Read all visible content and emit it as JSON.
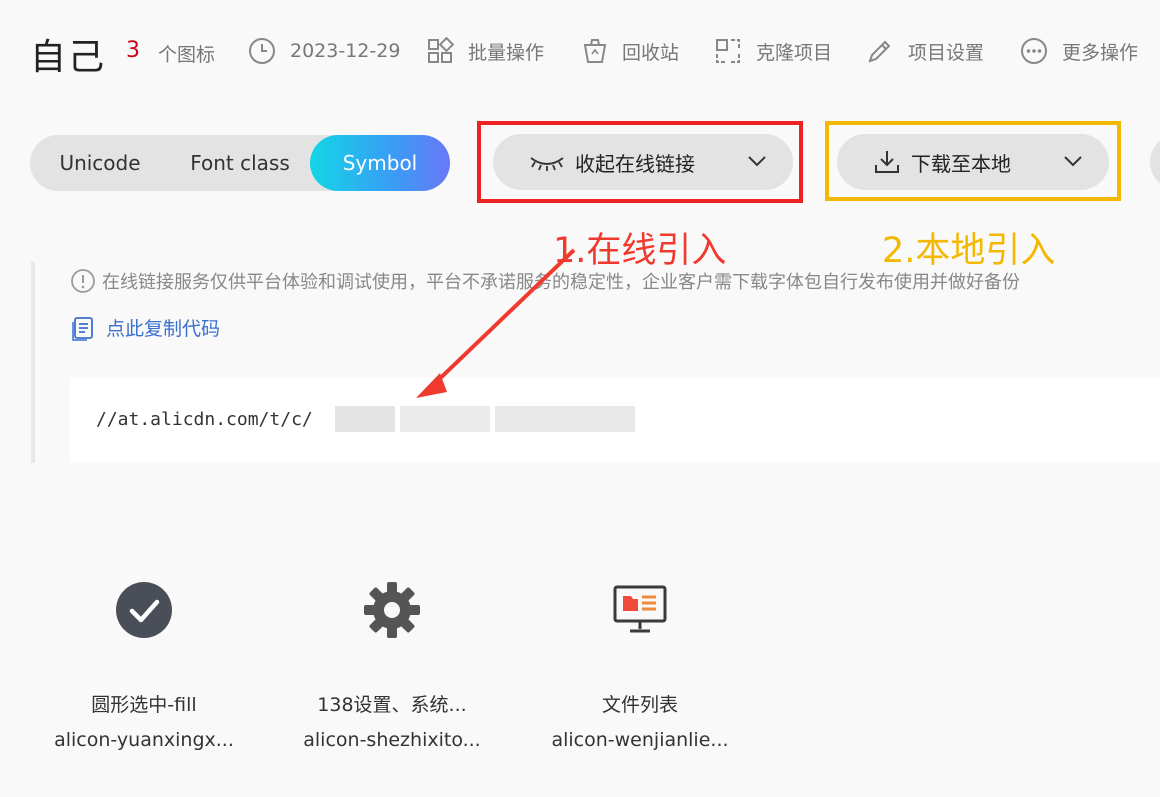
{
  "header": {
    "title": "自己",
    "icon_count": "3",
    "icon_count_label": "个图标",
    "date": "2023-12-29",
    "actions": {
      "batch": "批量操作",
      "recycle": "回收站",
      "clone": "克隆项目",
      "settings": "项目设置",
      "more": "更多操作"
    }
  },
  "tabs": [
    {
      "label": "Unicode",
      "active": false
    },
    {
      "label": "Font class",
      "active": false
    },
    {
      "label": "Symbol",
      "active": true
    }
  ],
  "online_dropdown": {
    "label": "收起在线链接"
  },
  "download_dropdown": {
    "label": "下载至本地"
  },
  "annotations": {
    "online": "1.在线引入",
    "local": "2.本地引入",
    "red_color": "#ee2222",
    "yellow_color": "#f5b800"
  },
  "notice": "在线链接服务仅供平台体验和调试使用，平台不承诺服务的稳定性，企业客户需下载字体包自行发布使用并做好备份",
  "copy_code_label": "点此复制代码",
  "code_prefix": "//at.alicdn.com/t/c/",
  "icons": [
    {
      "name": "圆形选中-fill",
      "class": "alicon-yuanxingx...",
      "icon": "check-circle-icon"
    },
    {
      "name": "138设置、系统...",
      "class": "alicon-shezhixito...",
      "icon": "gear-icon"
    },
    {
      "name": "文件列表",
      "class": "alicon-wenjianlie...",
      "icon": "file-list-monitor-icon"
    }
  ],
  "colors": {
    "accent_start": "#13d6e6",
    "accent_end": "#6a78f7",
    "link": "#3b6fd0",
    "count": "#d0021b"
  }
}
